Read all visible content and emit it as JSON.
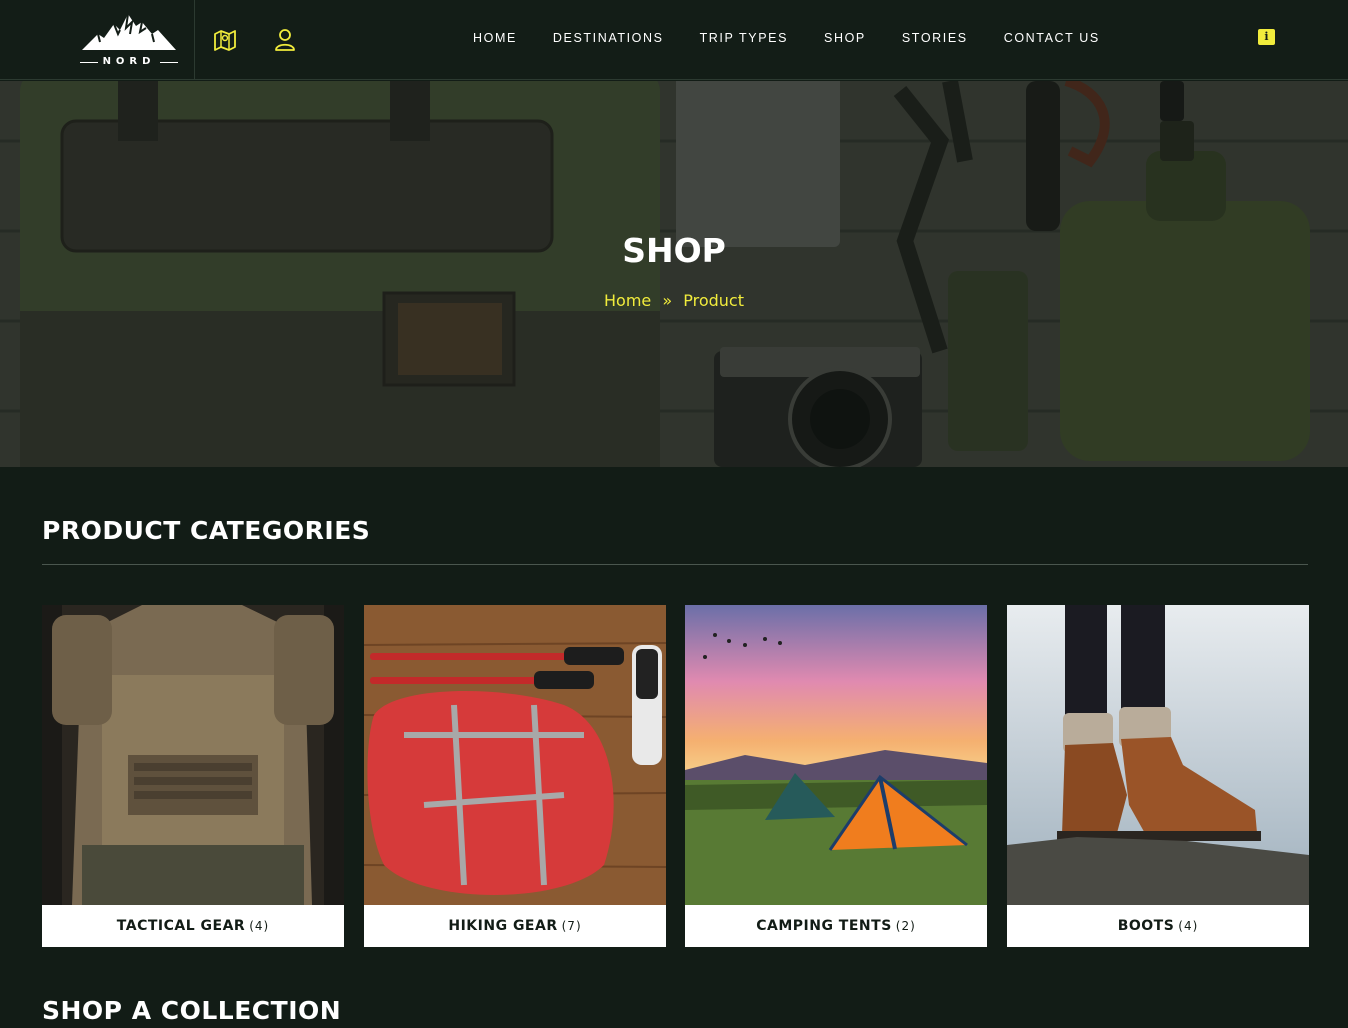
{
  "brand": {
    "logo_text": "NORD"
  },
  "header": {
    "icons": [
      "map-icon",
      "user-icon"
    ],
    "nav": [
      "HOME",
      "DESTINATIONS",
      "TRIP TYPES",
      "SHOP",
      "STORIES",
      "CONTACT US"
    ],
    "info_icon": "info-icon",
    "accent": "#f1ec3c"
  },
  "hero": {
    "title": "SHOP",
    "breadcrumb": {
      "home": "Home",
      "separator": "»",
      "current": "Product"
    }
  },
  "categories": {
    "title": "PRODUCT CATEGORIES",
    "items": [
      {
        "name": "TACTICAL GEAR",
        "count": "(4)"
      },
      {
        "name": "HIKING GEAR",
        "count": "(7)"
      },
      {
        "name": "CAMPING TENTS",
        "count": "(2)"
      },
      {
        "name": "BOOTS",
        "count": "(4)"
      }
    ]
  },
  "collection": {
    "title": "SHOP A COLLECTION"
  },
  "colors": {
    "background": "#121c16",
    "accent": "#f1ec3c",
    "card": "#ffffff"
  }
}
